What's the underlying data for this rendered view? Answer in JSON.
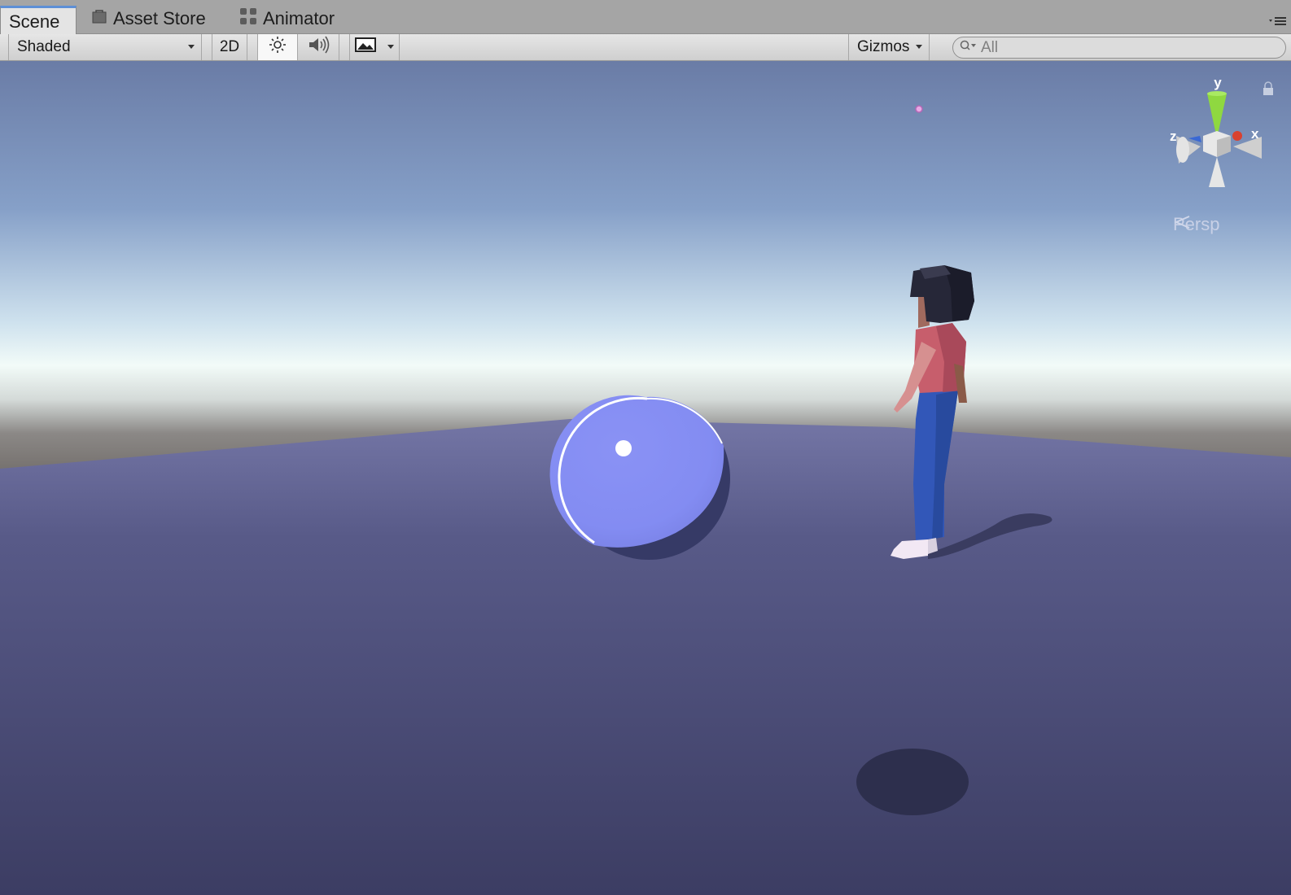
{
  "tabs": [
    {
      "label": "Scene",
      "active": true
    },
    {
      "label": "Asset Store",
      "icon": "shopping-bag-icon"
    },
    {
      "label": "Animator",
      "icon": "animator-nodes-icon"
    }
  ],
  "toolbar": {
    "draw_mode": "Shaded",
    "mode_2d": "2D",
    "lighting_icon": "sun-icon",
    "audio_icon": "speaker-icon",
    "effects_icon": "image-icon",
    "gizmos": "Gizmos",
    "search_placeholder": "All"
  },
  "scene_view": {
    "projection_label": "Persp",
    "axis_labels": {
      "x": "x",
      "y": "y",
      "z": "z"
    },
    "objects": [
      "sphere",
      "character",
      "ground-plane",
      "skybox"
    ]
  },
  "colors": {
    "active_tab_accent": "#5d8fd6",
    "sphere": "#858cf2",
    "ground": "#53557f",
    "axis_x": "#d9412f",
    "axis_y": "#8fd840",
    "axis_z": "#3a68d4"
  }
}
